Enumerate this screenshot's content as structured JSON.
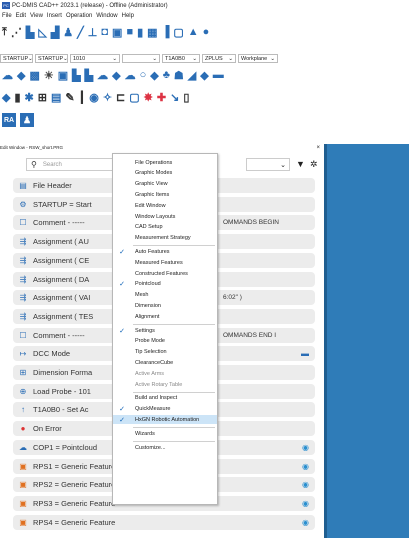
{
  "window": {
    "title": "PC-DMIS CAD++ 2023.1 (release) - Offline (Administrator)",
    "app_icon": "PC"
  },
  "menubar": [
    "File",
    "Edit",
    "View",
    "Insert",
    "Operation",
    "Window",
    "Help"
  ],
  "selectors": {
    "row1": [
      "STARTUP",
      "STARTUP",
      "1010",
      "",
      "T1A0B0",
      "ZPLUS",
      "Workplane"
    ]
  },
  "edit_window": {
    "title": "Edit Window - RSW_short.PRG",
    "close": "×"
  },
  "search": {
    "placeholder": "Search"
  },
  "rows": [
    {
      "icon": "file-header-icon",
      "label": "File Header",
      "right": ""
    },
    {
      "icon": "startup-icon",
      "label": "STARTUP = Start",
      "right": ""
    },
    {
      "icon": "comment-icon",
      "label": "Comment - -----",
      "right": "OMMANDS BEGIN"
    },
    {
      "icon": "assignment-icon",
      "label": "Assignment ( AU",
      "right": ""
    },
    {
      "icon": "assignment-icon",
      "label": "Assignment ( CE",
      "right": ""
    },
    {
      "icon": "assignment-icon",
      "label": "Assignment ( DA",
      "right": ""
    },
    {
      "icon": "assignment-icon",
      "label": "Assignment ( VAI",
      "right": "6:02\" )"
    },
    {
      "icon": "assignment-icon",
      "label": "Assignment ( TES",
      "right": ""
    },
    {
      "icon": "comment-icon",
      "label": "Comment - -----",
      "right": "OMMANDS END I"
    },
    {
      "icon": "dcc-icon",
      "label": "DCC Mode",
      "right": ""
    },
    {
      "icon": "dimension-icon",
      "label": "Dimension Forma",
      "right": ""
    },
    {
      "icon": "probe-icon",
      "label": "Load Probe - 101",
      "right": ""
    },
    {
      "icon": "tip-icon",
      "label": "T1A0B0 - Set Ac",
      "right": ""
    },
    {
      "icon": "error-icon",
      "label": "On Error",
      "right": ""
    },
    {
      "icon": "cloud-icon",
      "label": "COP1 = Pointcloud",
      "right": ""
    },
    {
      "icon": "feature-icon",
      "label": "RPS1 = Generic Feature",
      "right": ""
    },
    {
      "icon": "feature-icon",
      "label": "RPS2 = Generic Feature",
      "right": ""
    },
    {
      "icon": "feature-icon",
      "label": "RPS3 = Generic Feature",
      "right": ""
    },
    {
      "icon": "feature-icon",
      "label": "RPS4 = Generic Feature",
      "right": ""
    }
  ],
  "context_menu": [
    {
      "label": "File Operations",
      "checked": false,
      "disabled": false
    },
    {
      "label": "Graphic Modes",
      "checked": false,
      "disabled": false
    },
    {
      "label": "Graphic View",
      "checked": false,
      "disabled": false
    },
    {
      "label": "Graphic Items",
      "checked": false,
      "disabled": false
    },
    {
      "label": "Edit Window",
      "checked": false,
      "disabled": false
    },
    {
      "label": "Window Layouts",
      "checked": false,
      "disabled": false
    },
    {
      "label": "CAD Setup",
      "checked": false,
      "disabled": false
    },
    {
      "label": "Measurement Strategy",
      "checked": false,
      "disabled": false
    },
    {
      "label": "Auto Features",
      "checked": true,
      "disabled": false
    },
    {
      "label": "Measured Features",
      "checked": false,
      "disabled": false
    },
    {
      "label": "Constructed Features",
      "checked": false,
      "disabled": false
    },
    {
      "label": "Pointcloud",
      "checked": true,
      "disabled": false
    },
    {
      "label": "Mesh",
      "checked": false,
      "disabled": false
    },
    {
      "label": "Dimension",
      "checked": false,
      "disabled": false
    },
    {
      "label": "Alignment",
      "checked": false,
      "disabled": false
    },
    {
      "label": "Settings",
      "checked": true,
      "disabled": false
    },
    {
      "label": "Probe Mode",
      "checked": false,
      "disabled": false
    },
    {
      "label": "Tip Selection",
      "checked": false,
      "disabled": false
    },
    {
      "label": "ClearanceCube",
      "checked": false,
      "disabled": false
    },
    {
      "label": "Active Arms",
      "checked": false,
      "disabled": true
    },
    {
      "label": "Active Rotary Table",
      "checked": false,
      "disabled": true
    },
    {
      "label": "Build and Inspect",
      "checked": false,
      "disabled": false
    },
    {
      "label": "QuickMeasure",
      "checked": true,
      "disabled": false
    },
    {
      "label": "HxGN Robotic Automation",
      "checked": true,
      "disabled": false,
      "highlight": true
    },
    {
      "label": "Wizards",
      "checked": false,
      "disabled": false
    },
    {
      "label": "Customize...",
      "checked": false,
      "disabled": false
    }
  ],
  "colors": {
    "accent": "#2f7cb8",
    "menu_highlight": "#cce4f7",
    "row_bg": "#ececec"
  }
}
